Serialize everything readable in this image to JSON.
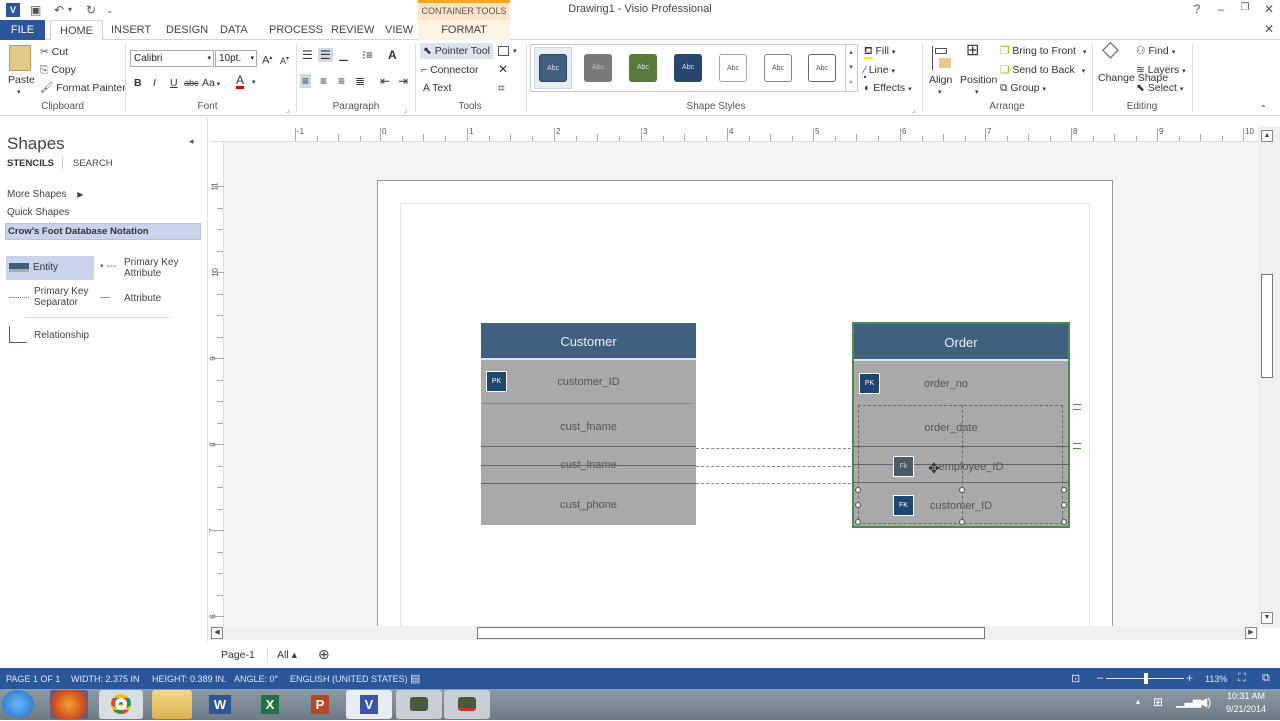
{
  "window": {
    "title": "Drawing1 - Visio Professional",
    "help": "?",
    "minimize": "–",
    "restore": "❐",
    "close": "✕",
    "ribbon_close": "✕"
  },
  "qat": {
    "app_icon": "V",
    "save": "💾",
    "undo": "↶",
    "undo_drop": "▾",
    "redo": "↻",
    "customize": "⩡"
  },
  "tabs": {
    "file": "FILE",
    "home": "HOME",
    "insert": "INSERT",
    "design": "DESIGN",
    "data": "DATA",
    "process": "PROCESS",
    "review": "REVIEW",
    "view": "VIEW",
    "context_group": "CONTAINER TOOLS",
    "format": "FORMAT"
  },
  "ribbon": {
    "clipboard": {
      "paste": "Paste",
      "cut": "Cut",
      "copy": "Copy",
      "format_painter": "Format Painter",
      "label": "Clipboard"
    },
    "font": {
      "name": "Calibri",
      "size": "10pt.",
      "grow": "A˄",
      "shrink": "A˅",
      "bold": "B",
      "italic": "I",
      "underline": "U",
      "strike": "abc",
      "case": "Aa",
      "color": "A",
      "label": "Font"
    },
    "paragraph": {
      "label": "Paragraph"
    },
    "tools": {
      "pointer": "Pointer Tool",
      "connector": "Connector",
      "text": "Text",
      "label": "Tools"
    },
    "shape_styles": {
      "swatches": [
        "Abc",
        "Abc",
        "Abc",
        "Abc",
        "Abc",
        "Abc",
        "Abc"
      ],
      "label": "Shape Styles",
      "fill": "Fill",
      "line": "Line",
      "effects": "Effects"
    },
    "arrange": {
      "align": "Align",
      "position": "Position",
      "bring_front": "Bring to Front",
      "send_back": "Send to Back",
      "group": "Group",
      "label": "Arrange"
    },
    "editing": {
      "change_shape": "Change Shape",
      "find": "Find",
      "layers": "Layers",
      "select": "Select",
      "label": "Editing"
    }
  },
  "shapes_pane": {
    "title": "Shapes",
    "tab_stencils": "STENCILS",
    "tab_search": "SEARCH",
    "more_shapes": "More Shapes",
    "quick_shapes": "Quick Shapes",
    "stencil": "Crow's Foot Database Notation",
    "items": [
      "Entity",
      "Primary Key Attribute",
      "Primary Key Separator",
      "Attribute",
      "Relationship"
    ]
  },
  "rulers": {
    "horizontal": [
      "-1",
      "0",
      "1",
      "2",
      "3",
      "4",
      "5",
      "6",
      "7",
      "8",
      "9",
      "10"
    ],
    "vertical": [
      "11",
      "10",
      "9",
      "8",
      "7",
      "6"
    ]
  },
  "diagram": {
    "customer": {
      "title": "Customer",
      "pk_badge": "PK",
      "pk": "customer_ID",
      "attrs": [
        "cust_fname",
        "cust_lname",
        "cust_phone"
      ]
    },
    "order": {
      "title": "Order",
      "pk_badge": "PK",
      "pk": "order_no",
      "attrs": [
        "order_date",
        "employee_ID"
      ],
      "fk_badge": "FK",
      "fk": "customer_ID"
    }
  },
  "page_tabs": {
    "page": "Page-1",
    "all": "All ▴",
    "add": "⊕"
  },
  "status": {
    "page": "PAGE 1 OF 1",
    "width": "WIDTH: 2.375 IN",
    "height": "HEIGHT: 0.389 IN.",
    "angle": "ANGLE: 0°",
    "language": "ENGLISH (UNITED STATES)",
    "zoom": "113%"
  },
  "taskbar": {
    "apps": [
      "Start",
      "Firefox",
      "Chrome",
      "Explorer",
      "W",
      "X",
      "P",
      "V",
      "App",
      "App"
    ],
    "time": "10:31 AM",
    "date": "9/21/2014"
  }
}
